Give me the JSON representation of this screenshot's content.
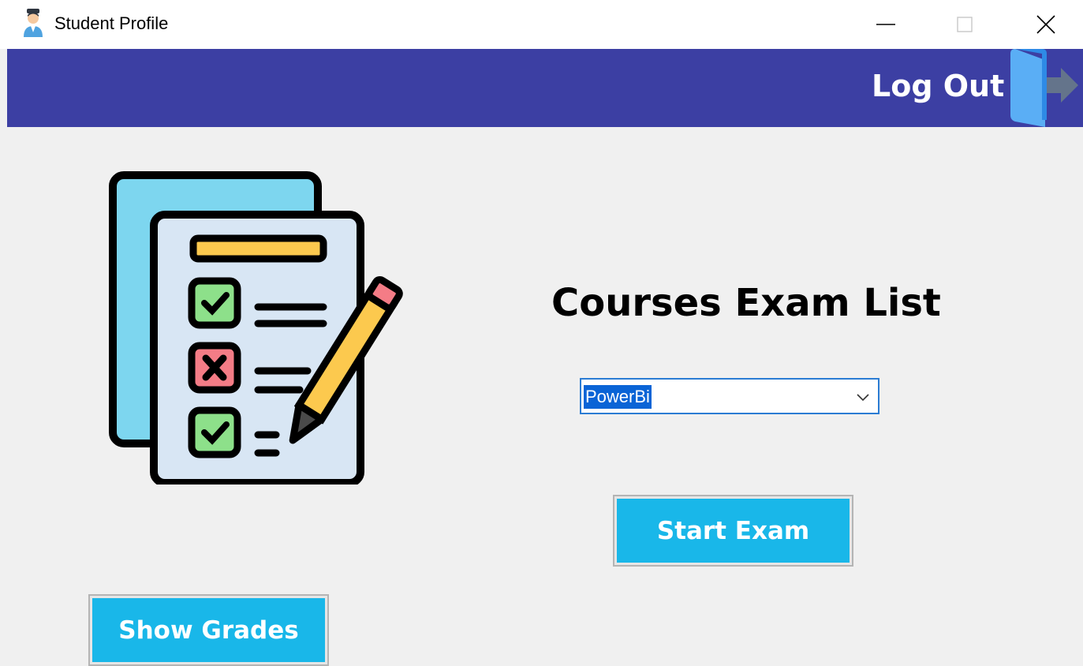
{
  "window": {
    "title": "Student Profile",
    "controls": {
      "minimize": "minimize",
      "maximize": "maximize",
      "close": "close"
    }
  },
  "header": {
    "logout_label": "Log Out",
    "logout_icon": "logout-door-icon",
    "background": "#3c3fa3"
  },
  "main": {
    "illustration": "exam-checklist-icon",
    "title": "Courses Exam List",
    "course_select": {
      "value": "PowerBi"
    },
    "start_button": "Start Exam",
    "grades_button": "Show Grades",
    "accent_color": "#19b7e9"
  }
}
